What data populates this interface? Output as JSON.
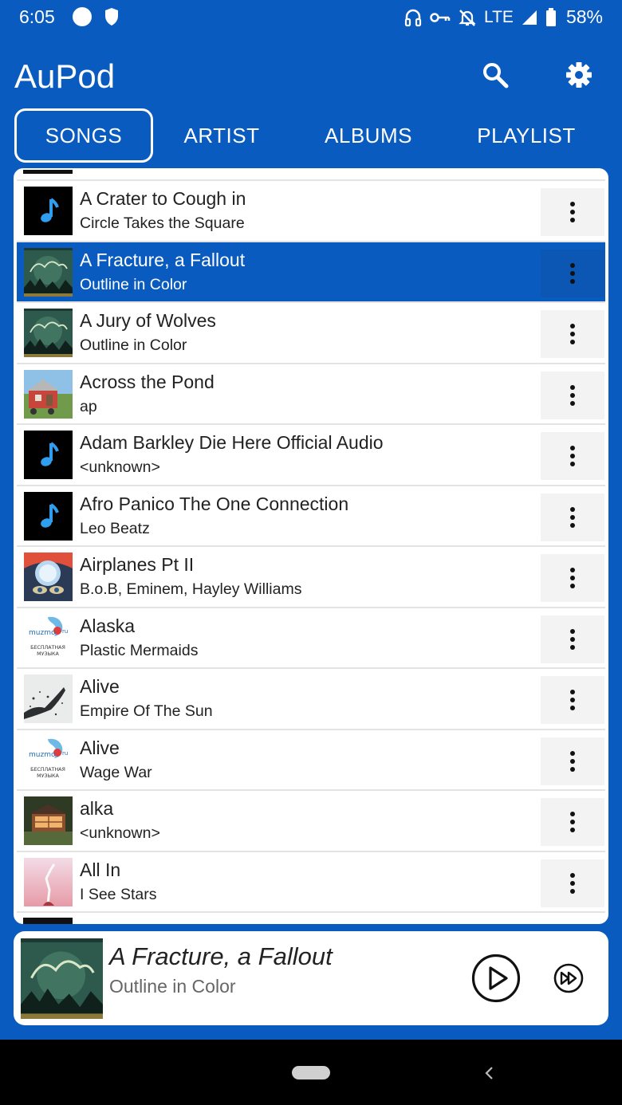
{
  "status_bar": {
    "time": "6:05",
    "network": "LTE",
    "battery": "58%",
    "icons": [
      "circle-icon",
      "shield-icon",
      "headphones-icon",
      "vpn-key-icon",
      "notifications-off-icon",
      "signal-icon",
      "battery-icon"
    ]
  },
  "app_bar": {
    "title": "AuPod",
    "icons": [
      "search-icon",
      "settings-icon"
    ]
  },
  "tabs": [
    {
      "label": "SONGS",
      "active": true
    },
    {
      "label": "ARTIST",
      "active": false
    },
    {
      "label": "ALBUMS",
      "active": false
    },
    {
      "label": "PLAYLIST",
      "active": false
    }
  ],
  "songs": [
    {
      "title": "A Crater to Cough in",
      "artist": "Circle Takes the Square",
      "art": "music-note"
    },
    {
      "title": "A Fracture, a Fallout",
      "artist": "Outline in Color",
      "art": "outline-in-color",
      "selected": true
    },
    {
      "title": "A Jury of Wolves",
      "artist": "Outline in Color",
      "art": "outline-in-color"
    },
    {
      "title": "Across the Pond",
      "artist": "ap",
      "art": "tiny-house"
    },
    {
      "title": "Adam Barkley  Die Here  Official Audio",
      "artist": "<unknown>",
      "art": "music-note"
    },
    {
      "title": "Afro Panico  The One Connection",
      "artist": "Leo Beatz",
      "art": "music-note"
    },
    {
      "title": "Airplanes Pt II",
      "artist": "B.o.B, Eminem, Hayley Williams",
      "art": "airplanes"
    },
    {
      "title": "Alaska",
      "artist": "Plastic Mermaids",
      "art": "muzmo"
    },
    {
      "title": "Alive",
      "artist": "Empire Of The Sun",
      "art": "splatter"
    },
    {
      "title": "Alive",
      "artist": "Wage War",
      "art": "muzmo"
    },
    {
      "title": "alka",
      "artist": "<unknown>",
      "art": "cabin"
    },
    {
      "title": "All In",
      "artist": "I See Stars",
      "art": "pink-figure"
    }
  ],
  "muzmo_art": {
    "brand": "muzmo",
    "domain": "ru",
    "line1": "БЕСПЛАТНАЯ",
    "line2": "МУЗЫКА"
  },
  "now_playing": {
    "title": "A Fracture, a Fallout",
    "artist": "Outline in Color",
    "icons": [
      "play-icon",
      "fast-forward-icon"
    ]
  },
  "nav_bar": {
    "icons": [
      "home-pill-icon",
      "back-chevron-icon"
    ]
  },
  "colors": {
    "primary": "#0a5bbf",
    "selected_row": "#0a5bbf",
    "more_button_bg": "#f3f3f3",
    "text": "#222222"
  }
}
